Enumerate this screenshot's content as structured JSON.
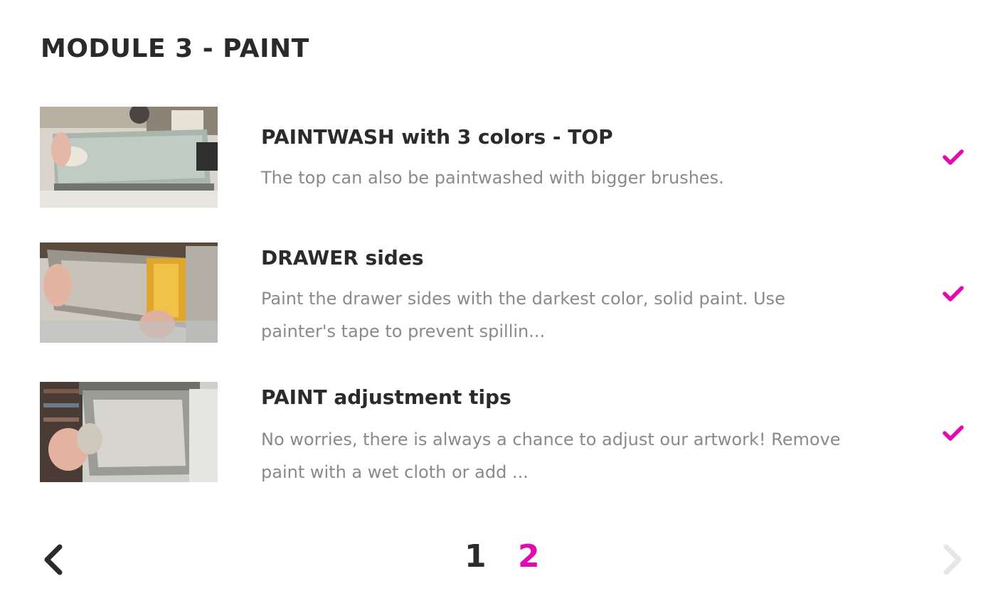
{
  "module": {
    "title": "MODULE 3 - PAINT"
  },
  "lessons": [
    {
      "title": "PAINTWASH with 3 colors - TOP",
      "description": "The top can also be paintwashed with bigger brushes.",
      "completed": true,
      "icon": "check-icon"
    },
    {
      "title": "DRAWER sides",
      "description": "Paint the drawer sides with the darkest color, solid paint. Use painter's tape to prevent spillin...",
      "completed": true,
      "icon": "check-icon"
    },
    {
      "title": "PAINT adjustment tips",
      "description": "No worries, there is always a chance to adjust our artwork! Remove paint with a wet cloth or add ...",
      "completed": true,
      "icon": "check-icon"
    }
  ],
  "pagination": {
    "pages": [
      "1",
      "2"
    ],
    "current_page": "2",
    "prev_icon": "chevron-left-icon",
    "next_icon": "chevron-right-icon",
    "next_disabled": true
  },
  "colors": {
    "accent": "#e20bb0",
    "text": "#2b2b2b",
    "muted": "#8a8a8a",
    "disabled": "#e6e6e6"
  }
}
